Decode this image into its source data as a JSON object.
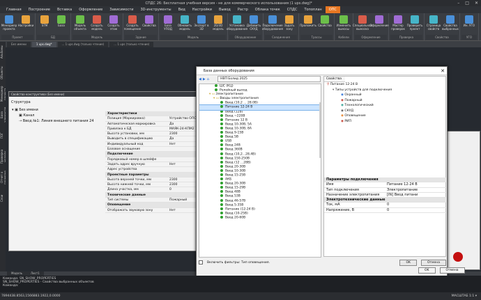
{
  "title": "СПДС 26: Бесплатная учебная версия - не для коммерческого использования (1 ups.dwg)*",
  "menu": [
    "Главная",
    "Построение",
    "Вставка",
    "Оформление",
    "Зависимости",
    "3D-инструменты",
    "Вид",
    "Настройки",
    "Вывод",
    "Растр",
    "Облака точек",
    "СПДС",
    "Топоплан",
    "ОПС"
  ],
  "ribbon": [
    {
      "name": "Проект",
      "btns": [
        "Менеджер проекта",
        "Настройки"
      ]
    },
    {
      "name": "БД",
      "btns": [
        "STM",
        "База"
      ]
    },
    {
      "name": "Модель",
      "btns": [
        "Модель объекта",
        "Создать модель",
        "Создать этаж"
      ]
    },
    {
      "name": "Здание",
      "btns": [
        "Создать помещение",
        "Свойства"
      ]
    },
    {
      "name": "Модель",
      "btns": [
        "База УПОД",
        "Обновить модель",
        "Экспорт в 3D",
        "2D/3D модель"
      ]
    },
    {
      "name": "Оборудование",
      "btns": [
        "Установка оборудования",
        "Добавить СКУД"
      ]
    },
    {
      "name": "Соединения",
      "btns": [
        "Подключение оборудования",
        "Задать зону"
      ]
    },
    {
      "name": "Трассы",
      "btns": [
        "Проложить",
        "Свойства"
      ]
    },
    {
      "name": "Кабели",
      "btns": [
        "Изменить выносы"
      ]
    },
    {
      "name": "Оформление",
      "btns": [
        "Специальная выноска",
        "Оформление"
      ]
    },
    {
      "name": "Проверка",
      "btns": [
        "Мастер проверок",
        "Проверить проект"
      ]
    },
    {
      "name": "Свойства",
      "btns": [
        "Страница свойств",
        "Свойства выбранных"
      ]
    },
    {
      "name": "УГО",
      "btns": [
        "Ин. УГО"
      ]
    }
  ],
  "doctabs": [
    "Без имени",
    "1 ups.dwg*",
    "... 1 ups.dwg (только чтение)",
    "... 1 ups (только чтение)"
  ],
  "lefttabs": [
    "Альбомы",
    "Объекты",
    "Менеджер проекта",
    "База элементов",
    "ПОГ",
    "Проверка модели",
    "Отчет о проверке",
    "Слои"
  ],
  "props": {
    "header": "Свойства конструктива (Без имени)",
    "structure_label": "Структура",
    "tree": [
      "Без имени",
      "Канал",
      "Ввод №1: Линия внешнего питания 24"
    ],
    "rows": [
      {
        "k": "Характеристики",
        "v": "",
        "sec": true
      },
      {
        "k": "Позиция (Маркировка)",
        "v": "Устройство ОПС"
      },
      {
        "k": "Автоматическая маркировка",
        "v": "Да"
      },
      {
        "k": "Привязка к БД",
        "v": "МАЯК-24-КПМ2"
      },
      {
        "k": "Высота установки, мм",
        "v": "2300"
      },
      {
        "k": "Выводить в спецификацию",
        "v": "Да"
      },
      {
        "k": "Индивидуальный код",
        "v": "Нет"
      },
      {
        "k": "Базовое оснащение",
        "v": ""
      },
      {
        "k": "Подключение",
        "v": "",
        "sec": true
      },
      {
        "k": "Порядковый номер в шлейфе",
        "v": ""
      },
      {
        "k": "Задать адрес вручную",
        "v": "Нет"
      },
      {
        "k": "Адрес устройства",
        "v": ""
      },
      {
        "k": "Проектные параметры",
        "v": "",
        "sec": true
      },
      {
        "k": "Высота верхней точки, мм",
        "v": "2300"
      },
      {
        "k": "Высота нижней точки, мм",
        "v": "2300"
      },
      {
        "k": "Длина участка, мм",
        "v": "0"
      },
      {
        "k": "Технические данные",
        "v": "",
        "sec": true
      },
      {
        "k": "Тип системы",
        "v": "Пожарный"
      },
      {
        "k": "Оповещение",
        "v": "",
        "sec": true
      },
      {
        "k": "Отображать звуковую зону",
        "v": "Нет"
      }
    ]
  },
  "db": {
    "title": "База данных оборудования",
    "search": "НВП Болид 2025",
    "tree": [
      "ШС (КЦ)",
      "Релейный выход",
      "Электропитание",
      "Вводы электропитания",
      "Ввод (10,2 ... 28.0В)",
      "Питание 12-24 В",
      "Ввод (12В)",
      "Ввод ~220В",
      "Питание 12 В",
      "Ввод 10-30В, 5А",
      "Ввод 10-30В, 8А",
      "Ввод 9-15В",
      "Ввод 5В",
      "USB",
      "Ввод 24В",
      "Ввод 360В",
      "Ввод (10,2...28.4В)",
      "Ввод 150-250В",
      "Ввод (12 ...28В)",
      "Ввод 20-30В",
      "Ввод 10-30В",
      "Ввод 15-25В",
      "АКБ",
      "Ввод 20-30В",
      "Ввод 15-29В",
      "Ввод 48В",
      "Ввод 53В",
      "Ввод 46-57В",
      "Ввод 5-35В",
      "Питание (12-24 В)",
      "Ввод (10-25В)",
      "Ввод 20-60В"
    ],
    "selected_index": 5,
    "right_tab": "Свойства",
    "right_tree": [
      "Питание 12-24 В",
      "Типы устройств для подключения",
      "Охранный",
      "Пожарный",
      "Технологический",
      "СКУД",
      "Оповещение",
      "РИП"
    ],
    "conn_rows": [
      {
        "k": "Параметры подключения",
        "v": "",
        "sec": true
      },
      {
        "k": "Имя",
        "v": "Питание 12-24 В"
      },
      {
        "k": "Тип подключения",
        "v": "Электропитание"
      },
      {
        "k": "Назначение электропитания",
        "v": "[IN] Ввод питани"
      },
      {
        "k": "Электротехнические данные",
        "v": "",
        "sec": true
      },
      {
        "k": "Ток, мА",
        "v": "0"
      },
      {
        "k": "Напряжение, В",
        "v": "0"
      }
    ],
    "filter_label": "Включить фильтры: Тип оповещения.",
    "ok": "OK",
    "cancel": "Отмена"
  },
  "outer": {
    "ok": "OK",
    "cancel": "Отмена"
  },
  "modeltabs": [
    "Модель",
    "Лист1"
  ],
  "cmd": [
    "Команда: SN_SHOW_PROPERTIES",
    "SN_SHOW_PROPERTIES - Свойства выбранных объектов",
    "Команда:"
  ],
  "status_left": "7894438.8563,1566883.1922,0.0000",
  "status_right": "МАСШТАБ 1:1 ▾",
  "colors": {
    "accent": "#e87722",
    "bg": "#3c3f44"
  }
}
